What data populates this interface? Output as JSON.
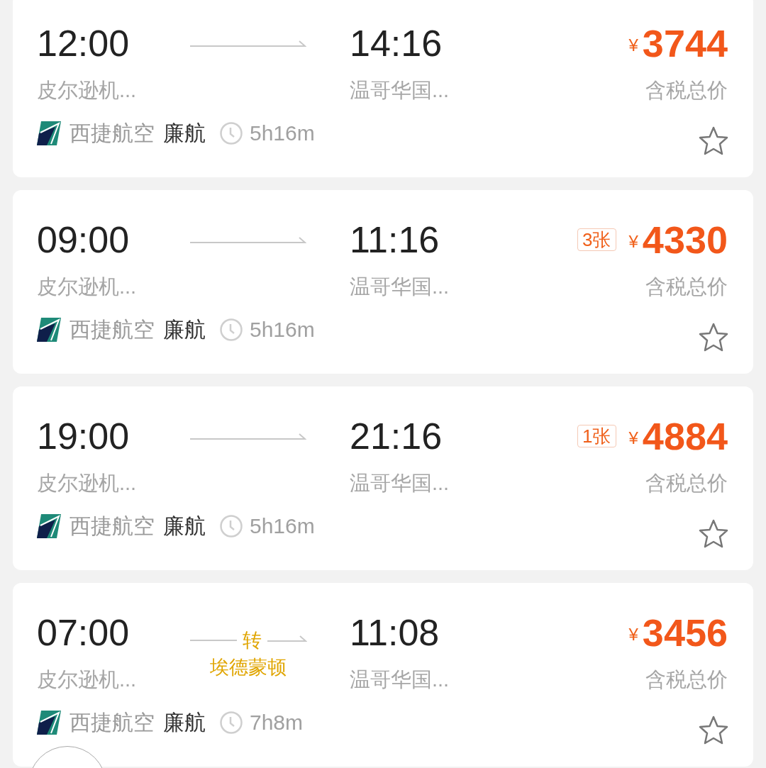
{
  "flights": [
    {
      "depart_time": "12:00",
      "depart_airport": "皮尔逊机...",
      "arrive_time": "14:16",
      "arrive_airport": "温哥华国...",
      "currency": "¥",
      "price": "3744",
      "price_note": "含税总价",
      "airline": "西捷航空",
      "operator": "廉航",
      "duration": "5h16m",
      "starred": false
    },
    {
      "depart_time": "09:00",
      "depart_airport": "皮尔逊机...",
      "arrive_time": "11:16",
      "arrive_airport": "温哥华国...",
      "tickets_left": "3张",
      "currency": "¥",
      "price": "4330",
      "price_note": "含税总价",
      "airline": "西捷航空",
      "operator": "廉航",
      "duration": "5h16m",
      "starred": false
    },
    {
      "depart_time": "19:00",
      "depart_airport": "皮尔逊机...",
      "arrive_time": "21:16",
      "arrive_airport": "温哥华国...",
      "tickets_left": "1张",
      "currency": "¥",
      "price": "4884",
      "price_note": "含税总价",
      "airline": "西捷航空",
      "operator": "廉航",
      "duration": "5h16m",
      "starred": false
    },
    {
      "depart_time": "07:00",
      "depart_airport": "皮尔逊机...",
      "arrive_time": "11:08",
      "arrive_airport": "温哥华国...",
      "transfer": {
        "label": "转",
        "city": "埃德蒙顿"
      },
      "currency": "¥",
      "price": "3456",
      "price_note": "含税总价",
      "airline": "西捷航空",
      "operator": "廉航",
      "duration": "7h8m",
      "starred": false
    }
  ]
}
